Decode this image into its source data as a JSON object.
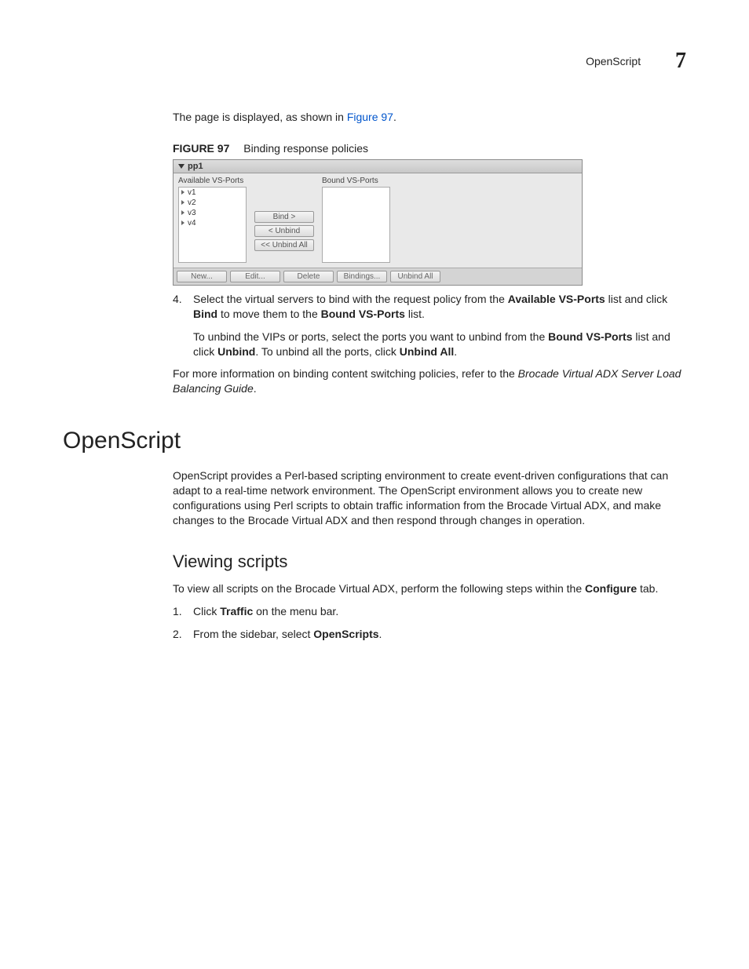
{
  "header": {
    "section_name": "OpenScript",
    "chapter_num": "7"
  },
  "intro": {
    "line1_pre": "The page is displayed, as shown in ",
    "line1_link": "Figure 97",
    "line1_post": "."
  },
  "figure": {
    "label": "FIGURE 97",
    "title": "Binding response policies",
    "panel_title": "pp1",
    "avail_label": "Available VS-Ports",
    "bound_label": "Bound VS-Ports",
    "avail_items": [
      "v1",
      "v2",
      "v3",
      "v4"
    ],
    "btn_bind": "Bind >",
    "btn_unbind": "< Unbind",
    "btn_unbind_all": "<< Unbind All",
    "footer": {
      "new": "New...",
      "edit": "Edit...",
      "delete": "Delete",
      "bindings": "Bindings...",
      "unbind_all": "Unbind All"
    }
  },
  "step4": {
    "num": "4.",
    "t1": "Select the virtual servers to bind with the request policy from the ",
    "b1": "Available VS-Ports",
    "t2": " list and click ",
    "b2": "Bind",
    "t3": " to move them to the ",
    "b3": "Bound VS-Ports",
    "t4": " list.",
    "s1": "To unbind the VIPs or ports, select the ports you want to unbind from the ",
    "sb1": "Bound VS-Ports",
    "s2": " list and click ",
    "sb2": "Unbind",
    "s3": ". To unbind all the ports, click ",
    "sb3": "Unbind All",
    "s4": "."
  },
  "moreinfo": {
    "t1": "For more information on binding content switching policies, refer to the ",
    "i1": "Brocade Virtual ADX Server Load Balancing Guide",
    "t2": "."
  },
  "openscript": {
    "heading": "OpenScript",
    "para": "OpenScript provides a Perl-based scripting environment to create event-driven configurations that can adapt to a real-time network environment. The OpenScript environment allows you to create new configurations using Perl scripts to obtain traffic information from the Brocade Virtual ADX, and make changes to the Brocade Virtual ADX and then respond through changes in operation."
  },
  "viewing": {
    "heading": "Viewing scripts",
    "intro_pre": "To view all scripts on the Brocade Virtual ADX, perform the following steps within the ",
    "intro_b": "Configure",
    "intro_post": " tab.",
    "s1_num": "1.",
    "s1_t1": "Click ",
    "s1_b": "Traffic",
    "s1_t2": " on the menu bar.",
    "s2_num": "2.",
    "s2_t1": "From the sidebar, select ",
    "s2_b": "OpenScripts",
    "s2_t2": "."
  }
}
